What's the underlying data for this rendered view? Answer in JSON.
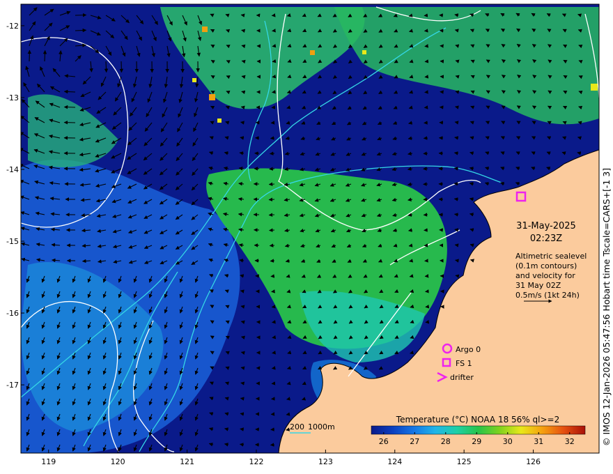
{
  "map": {
    "lon_range": [
      118.6,
      126.95
    ],
    "lat_range": [
      -17.95,
      -11.7
    ],
    "lon_ticks": [
      119,
      120,
      121,
      122,
      123,
      124,
      125,
      126
    ],
    "lat_ticks": [
      -12,
      -13,
      -14,
      -15,
      -16,
      -17
    ],
    "colors": {
      "land": "#fbcb9d",
      "deep_water": "#0a1a8a",
      "coastline": "#000000",
      "contour": "#ffffff",
      "isobath": "#35d7e6",
      "marker": "#ee22ee"
    }
  },
  "annotations": {
    "date": "31-May-2025",
    "time": "02:23Z",
    "note_lines": [
      "Altimetric sealevel",
      "(0.1m contours)",
      "and velocity for",
      "31 May 02Z",
      "0.5m/s (1kt 24h)"
    ]
  },
  "legend": {
    "argo": "Argo 0",
    "fs": "FS 1",
    "drifter": "drifter",
    "isobath_200": "200",
    "isobath_1000": "1000m"
  },
  "colorbar": {
    "title": "Temperature (°C) NOAA 18 56% ql>=2",
    "ticks": [
      26,
      27,
      28,
      29,
      30,
      31,
      32
    ],
    "range": [
      25.6,
      32.5
    ],
    "stops": [
      "#0a1a8a",
      "#0b3fc0",
      "#1577e6",
      "#20b5e8",
      "#1ed0a6",
      "#27c44a",
      "#7fd21e",
      "#e8e81a",
      "#f5a00e",
      "#e55010",
      "#a81008"
    ]
  },
  "credit": {
    "text": "© IMOS 12-Jan-2026 05:47:56 Hobart time Tscale=CARS+[-1 3]"
  }
}
